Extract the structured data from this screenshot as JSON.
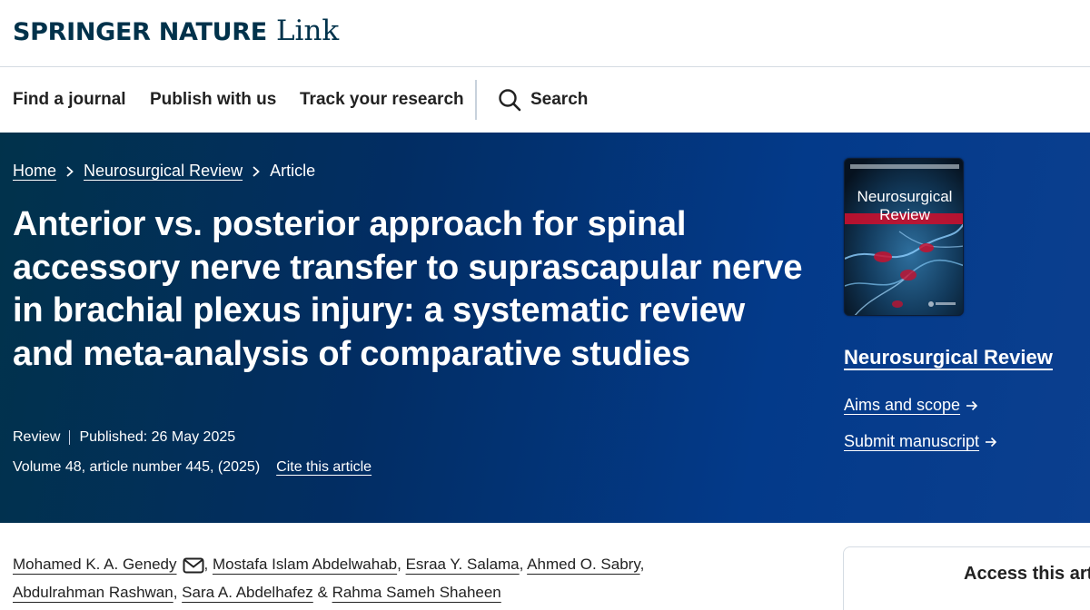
{
  "brand": {
    "name": "SPRINGER NATURE",
    "product": "Link"
  },
  "nav": {
    "items": [
      {
        "label": "Find a journal"
      },
      {
        "label": "Publish with us"
      },
      {
        "label": "Track your research"
      }
    ],
    "search_label": "Search"
  },
  "breadcrumb": [
    {
      "label": "Home"
    },
    {
      "label": "Neurosurgical Review"
    },
    {
      "label": "Article"
    }
  ],
  "article": {
    "title": "Anterior vs. posterior approach for spinal accessory nerve transfer to suprascapular nerve in brachial plexus injury: a systematic review and meta-analysis of comparative studies",
    "type": "Review",
    "published": "Published: 26 May 2025",
    "volume_info": "Volume 48, article number 445, (2025)",
    "cite_label": "Cite this article"
  },
  "journal": {
    "cover_title_line1": "Neurosurgical",
    "cover_title_line2": "Review",
    "name": "Neurosurgical Review",
    "aims_label": "Aims and scope",
    "submit_label": "Submit manuscript"
  },
  "authors": [
    "Mohamed K. A. Genedy",
    "Mostafa Islam Abdelwahab",
    "Esraa Y. Salama",
    "Ahmed O. Sabry",
    "Abdulrahman Rashwan",
    "Sara A. Abdelhafez",
    "Rahma Sameh Shaheen"
  ],
  "access": {
    "title": "Access this article"
  },
  "colors": {
    "brand": "#01324b",
    "hero_start": "#01324b",
    "hero_end": "#0b3f8f",
    "cover_accent": "#c8102e"
  },
  "icons": [
    "search-icon",
    "chevron-right-icon",
    "arrow-right-icon",
    "mail-icon"
  ]
}
